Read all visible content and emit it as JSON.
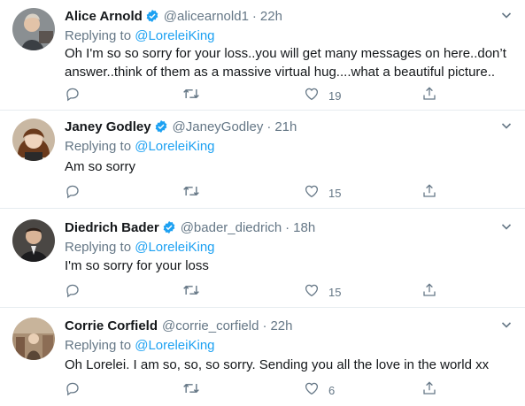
{
  "colors": {
    "accent": "#1da1f2",
    "secondary_text": "#657786",
    "divider": "#e6ecf0"
  },
  "replying_label": "Replying to",
  "tweets": [
    {
      "name": "Alice Arnold",
      "handle": "@alicearnold1",
      "dot": "·",
      "time": "22h",
      "replying_to": "@LoreleiKing",
      "text": "Oh I'm so so sorry for your loss..you will get many messages on here..don’t answer..think of them as a massive virtual hug....what a beautiful picture..",
      "likes": "19",
      "verified": true
    },
    {
      "name": "Janey Godley",
      "handle": "@JaneyGodley",
      "dot": "·",
      "time": "21h",
      "replying_to": "@LoreleiKing",
      "text": "Am so sorry",
      "likes": "15",
      "verified": true
    },
    {
      "name": "Diedrich Bader",
      "handle": "@bader_diedrich",
      "dot": "·",
      "time": "18h",
      "replying_to": "@LoreleiKing",
      "text": "I'm so sorry for your loss",
      "likes": "15",
      "verified": true
    },
    {
      "name": "Corrie Corfield",
      "handle": "@corrie_corfield",
      "dot": "·",
      "time": "22h",
      "replying_to": "@LoreleiKing",
      "text": "Oh Lorelei. I am so, so, so sorry. Sending you all the love in the world xx",
      "likes": "6",
      "verified": false
    }
  ]
}
